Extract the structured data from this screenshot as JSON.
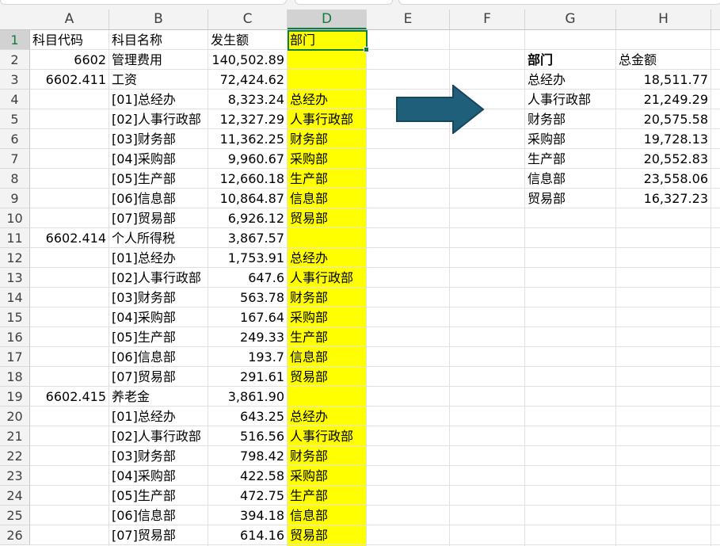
{
  "columns": [
    "A",
    "B",
    "C",
    "D",
    "E",
    "F",
    "G",
    "H"
  ],
  "rows": [
    "1",
    "2",
    "3",
    "4",
    "5",
    "6",
    "7",
    "8",
    "9",
    "10",
    "11",
    "12",
    "13",
    "14",
    "15",
    "16",
    "17",
    "18",
    "19",
    "20",
    "21",
    "22",
    "23",
    "24",
    "25",
    "26"
  ],
  "sheet": [
    {
      "a": "科目代码",
      "b": "科目名称",
      "c": "发生额",
      "d": "部门"
    },
    {
      "a": "6602",
      "b": "管理费用",
      "c": "140,502.89",
      "d": ""
    },
    {
      "a": "6602.411",
      "b": "工资",
      "c": "72,424.62",
      "d": ""
    },
    {
      "a": "",
      "b": "[01]总经办",
      "c": "8,323.24",
      "d": "总经办"
    },
    {
      "a": "",
      "b": "[02]人事行政部",
      "c": "12,327.29",
      "d": "人事行政部"
    },
    {
      "a": "",
      "b": "[03]财务部",
      "c": "11,362.25",
      "d": "财务部"
    },
    {
      "a": "",
      "b": "[04]采购部",
      "c": "9,960.67",
      "d": "采购部"
    },
    {
      "a": "",
      "b": "[05]生产部",
      "c": "12,660.18",
      "d": "生产部"
    },
    {
      "a": "",
      "b": "[06]信息部",
      "c": "10,864.87",
      "d": "信息部"
    },
    {
      "a": "",
      "b": "[07]贸易部",
      "c": "6,926.12",
      "d": "贸易部"
    },
    {
      "a": "6602.414",
      "b": "个人所得税",
      "c": "3,867.57",
      "d": ""
    },
    {
      "a": "",
      "b": "[01]总经办",
      "c": "1,753.91",
      "d": "总经办"
    },
    {
      "a": "",
      "b": "[02]人事行政部",
      "c": "647.6",
      "d": "人事行政部"
    },
    {
      "a": "",
      "b": "[03]财务部",
      "c": "563.78",
      "d": "财务部"
    },
    {
      "a": "",
      "b": "[04]采购部",
      "c": "167.64",
      "d": "采购部"
    },
    {
      "a": "",
      "b": "[05]生产部",
      "c": "249.33",
      "d": "生产部"
    },
    {
      "a": "",
      "b": "[06]信息部",
      "c": "193.7",
      "d": "信息部"
    },
    {
      "a": "",
      "b": "[07]贸易部",
      "c": "291.61",
      "d": "贸易部"
    },
    {
      "a": "6602.415",
      "b": "养老金",
      "c": "3,861.90",
      "d": ""
    },
    {
      "a": "",
      "b": "[01]总经办",
      "c": "643.25",
      "d": "总经办"
    },
    {
      "a": "",
      "b": "[02]人事行政部",
      "c": "516.56",
      "d": "人事行政部"
    },
    {
      "a": "",
      "b": "[03]财务部",
      "c": "798.42",
      "d": "财务部"
    },
    {
      "a": "",
      "b": "[04]采购部",
      "c": "422.58",
      "d": "采购部"
    },
    {
      "a": "",
      "b": "[05]生产部",
      "c": "472.75",
      "d": "生产部"
    },
    {
      "a": "",
      "b": "[06]信息部",
      "c": "394.18",
      "d": "信息部"
    },
    {
      "a": "",
      "b": "[07]贸易部",
      "c": "614.16",
      "d": "贸易部"
    }
  ],
  "summary": {
    "header_g": "部门",
    "header_h": "总金额",
    "rows": [
      {
        "g": "总经办",
        "h": "18,511.77"
      },
      {
        "g": "人事行政部",
        "h": "21,249.29"
      },
      {
        "g": "财务部",
        "h": "20,575.58"
      },
      {
        "g": "采购部",
        "h": "19,728.13"
      },
      {
        "g": "生产部",
        "h": "20,552.83"
      },
      {
        "g": "信息部",
        "h": "23,558.06"
      },
      {
        "g": "贸易部",
        "h": "16,327.23"
      }
    ]
  },
  "selected_cell": "D1",
  "colors": {
    "highlight": "#ffff00",
    "selection": "#107c41",
    "arrow": "#1f5f7a"
  }
}
